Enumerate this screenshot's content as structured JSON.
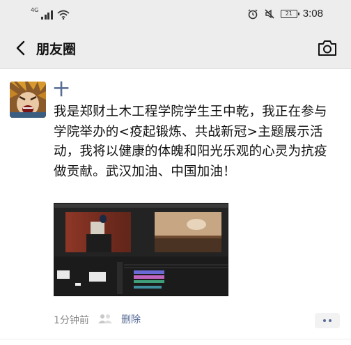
{
  "status_bar": {
    "network": "4G",
    "time": "3:08",
    "battery": "21",
    "icons": [
      "signal-icon",
      "wifi-icon",
      "alarm-icon",
      "mute-icon",
      "battery-icon"
    ]
  },
  "nav": {
    "title": "朋友圈",
    "back_icon": "chevron-left-icon",
    "camera_icon": "camera-icon"
  },
  "post": {
    "author": "十",
    "text": "我是郑财土木工程学院学生王中乾，我正在参与学院举办的<疫起锻炼、共战新冠>主题展示活动，我将以健康的体魄和阳光乐观的心灵为抗疫做贡献。武汉加油、中国加油！",
    "time": "1分钟前",
    "delete_label": "删除",
    "media_description": "video-editor-screenshot"
  },
  "colors": {
    "link": "#576b95",
    "bar_bg": "#ededed",
    "meta": "#888888"
  }
}
